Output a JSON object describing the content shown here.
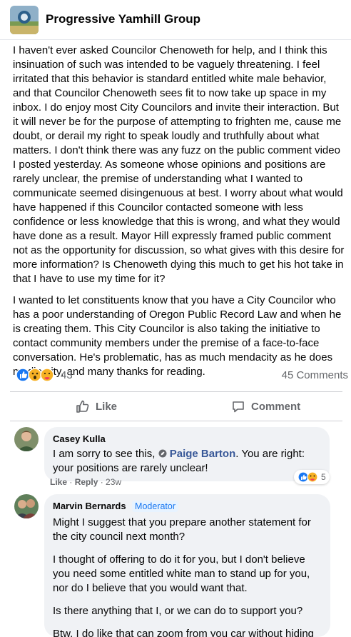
{
  "group": {
    "name": "Progressive Yamhill Group"
  },
  "post": {
    "paragraph1": "I haven't ever asked Councilor Chenoweth for help, and I think this insinuation of such was intended to be vaguely threatening. I feel irritated that this behavior is standard entitled white male behavior, and that Councilor Chenoweth sees fit to now take up space in my inbox. I do enjoy most City Councilors and invite their interaction. But it will never be for the purpose of attempting to frighten me, cause me doubt, or derail my right to speak loudly and truthfully about what matters. I don't think there was any fuzz on the public comment video I posted yesterday.  As someone whose opinions and positions are rarely unclear, the premise of understanding what I wanted to communicate seemed disingenuous at best. I worry about what would have happened if this Councilor contacted someone with less confidence or less knowledge that this is wrong, and what they would have done as a result. Mayor Hill expressly framed public comment not as the opportunity for discussion, so what gives with this desire for more information? Is Chenoweth dying this much to get his hot take in that I have to use my time for it?",
    "paragraph2": "I wanted to let constituents know that you have a City Councilor who has a poor understanding of Oregon Public Record Law and when he is creating them. This City Councilor is also taking the initiative to contact community members under the premise of a face-to-face conversation. He's problematic, has as much mendacity as he does mediocrity, and many thanks for reading.",
    "reaction_count": "43",
    "comments_count": "45 Comments"
  },
  "actions": {
    "like": "Like",
    "comment": "Comment"
  },
  "comments": [
    {
      "author": "Casey Kulla",
      "text_before": "I am sorry to see this,",
      "mention": "Paige Barton",
      "text_after": ". You are right: your positions are rarely unclear!",
      "like_label": "Like",
      "reply_label": "Reply",
      "time": "23w",
      "reaction_count": "5"
    },
    {
      "author": "Marvin Bernards",
      "badge": "Moderator",
      "paragraphs": [
        "Might I suggest that you prepare another statement for the city council next month?",
        "I thought of offering to do it for you, but I don't believe you need some entitled white man to stand up for you, nor do I believe that you would want that.",
        "Is there anything that I, or we can do to support you?",
        "Btw, I do like that can zoom from you car without hiding your background"
      ]
    }
  ],
  "colors": {
    "like_blue": "#1877f2",
    "love_red": "#f33e58",
    "wow_yellow": "#f7b125",
    "bubble_gray": "#f0f2f5"
  },
  "icons": [
    "group-photo",
    "like-reaction-icon",
    "wow-reaction-icon",
    "care-reaction-icon",
    "thumbs-up-icon",
    "comment-icon",
    "mention-icon"
  ]
}
